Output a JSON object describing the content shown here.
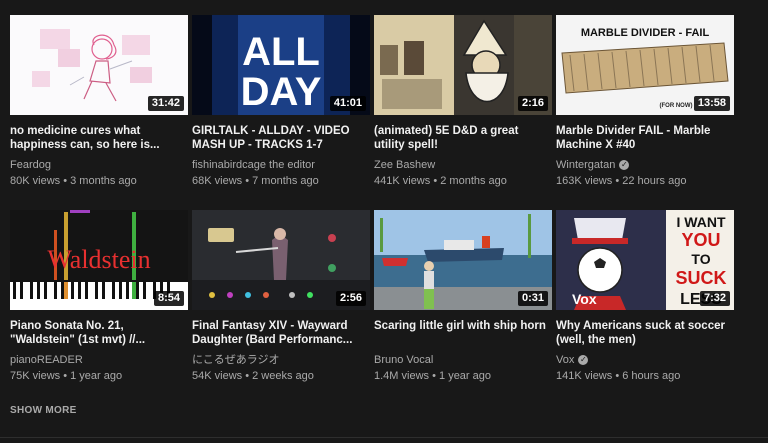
{
  "videos": [
    {
      "title": "no medicine cures what happiness can, so here is...",
      "channel": "Feardog",
      "views": "80K views",
      "age": "3 months ago",
      "duration": "31:42",
      "verified": false
    },
    {
      "title": "GIRLTALK - ALLDAY - VIDEO MASH UP - TRACKS 1-7",
      "channel": "fishinabirdcage the editor",
      "views": "68K views",
      "age": "7 months ago",
      "duration": "41:01",
      "verified": false,
      "thumb_text": [
        "ALL",
        "DAY"
      ]
    },
    {
      "title": "(animated) 5E D&D a great utility spell!",
      "channel": "Zee Bashew",
      "views": "441K views",
      "age": "2 months ago",
      "duration": "2:16",
      "verified": false
    },
    {
      "title": "Marble Divider FAIL - Marble Machine X #40",
      "channel": "Wintergatan",
      "views": "163K views",
      "age": "22 hours ago",
      "duration": "13:58",
      "verified": true,
      "thumb_text": [
        "MARBLE DIVIDER - FAIL",
        "(FOR NOW)"
      ]
    },
    {
      "title": "Piano Sonata No. 21, \"Waldstein\" (1st mvt) //...",
      "channel": "pianoREADER",
      "views": "75K views",
      "age": "1 year ago",
      "duration": "8:54",
      "verified": false,
      "thumb_text": [
        "Waldstein"
      ]
    },
    {
      "title": "Final Fantasy XIV - Wayward Daughter (Bard Performanc...",
      "channel": "にこるぜあラジオ",
      "views": "54K views",
      "age": "2 weeks ago",
      "duration": "2:56",
      "verified": false
    },
    {
      "title": "Scaring little girl with ship horn",
      "channel": "Bruno Vocal",
      "views": "1.4M views",
      "age": "1 year ago",
      "duration": "0:31",
      "verified": false
    },
    {
      "title": "Why Americans suck at soccer (well, the men)",
      "channel": "Vox",
      "views": "141K views",
      "age": "6 hours ago",
      "duration": "7:32",
      "verified": true,
      "thumb_text": [
        "I WANT",
        "YOU",
        "TO",
        "SUCK",
        "LESS",
        "Vox"
      ]
    }
  ],
  "meta_separator": "•",
  "verified_icon": "✓",
  "show_more_label": "SHOW MORE",
  "colors": {
    "background": "#181818",
    "title": "#f1f1f1",
    "secondary": "#aaaaaa",
    "duration_bg": "#000000"
  }
}
